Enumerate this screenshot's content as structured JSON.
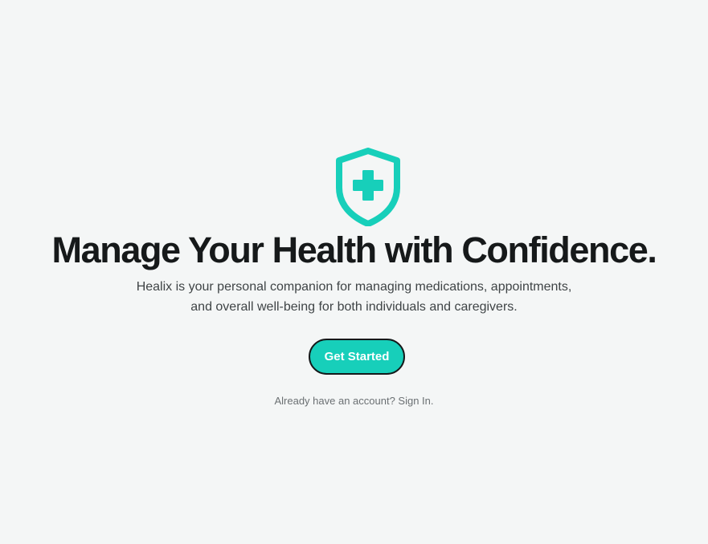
{
  "logo": {
    "icon": "shield-medical-cross-icon",
    "color": "#17cfba"
  },
  "hero": {
    "title": "Manage Your Health with Confidence.",
    "subtitle_line1": "Healix is your personal companion for managing medications, appointments,",
    "subtitle_line2": "and overall well-being for both individuals and caregivers."
  },
  "cta": {
    "label": "Get Started",
    "background": "#17cfba"
  },
  "signin": {
    "prompt": "Already have an account?",
    "link_label": "Sign In."
  },
  "colors": {
    "page_background": "#f4f6f6",
    "accent": "#17cfba",
    "heading": "#16191a"
  }
}
